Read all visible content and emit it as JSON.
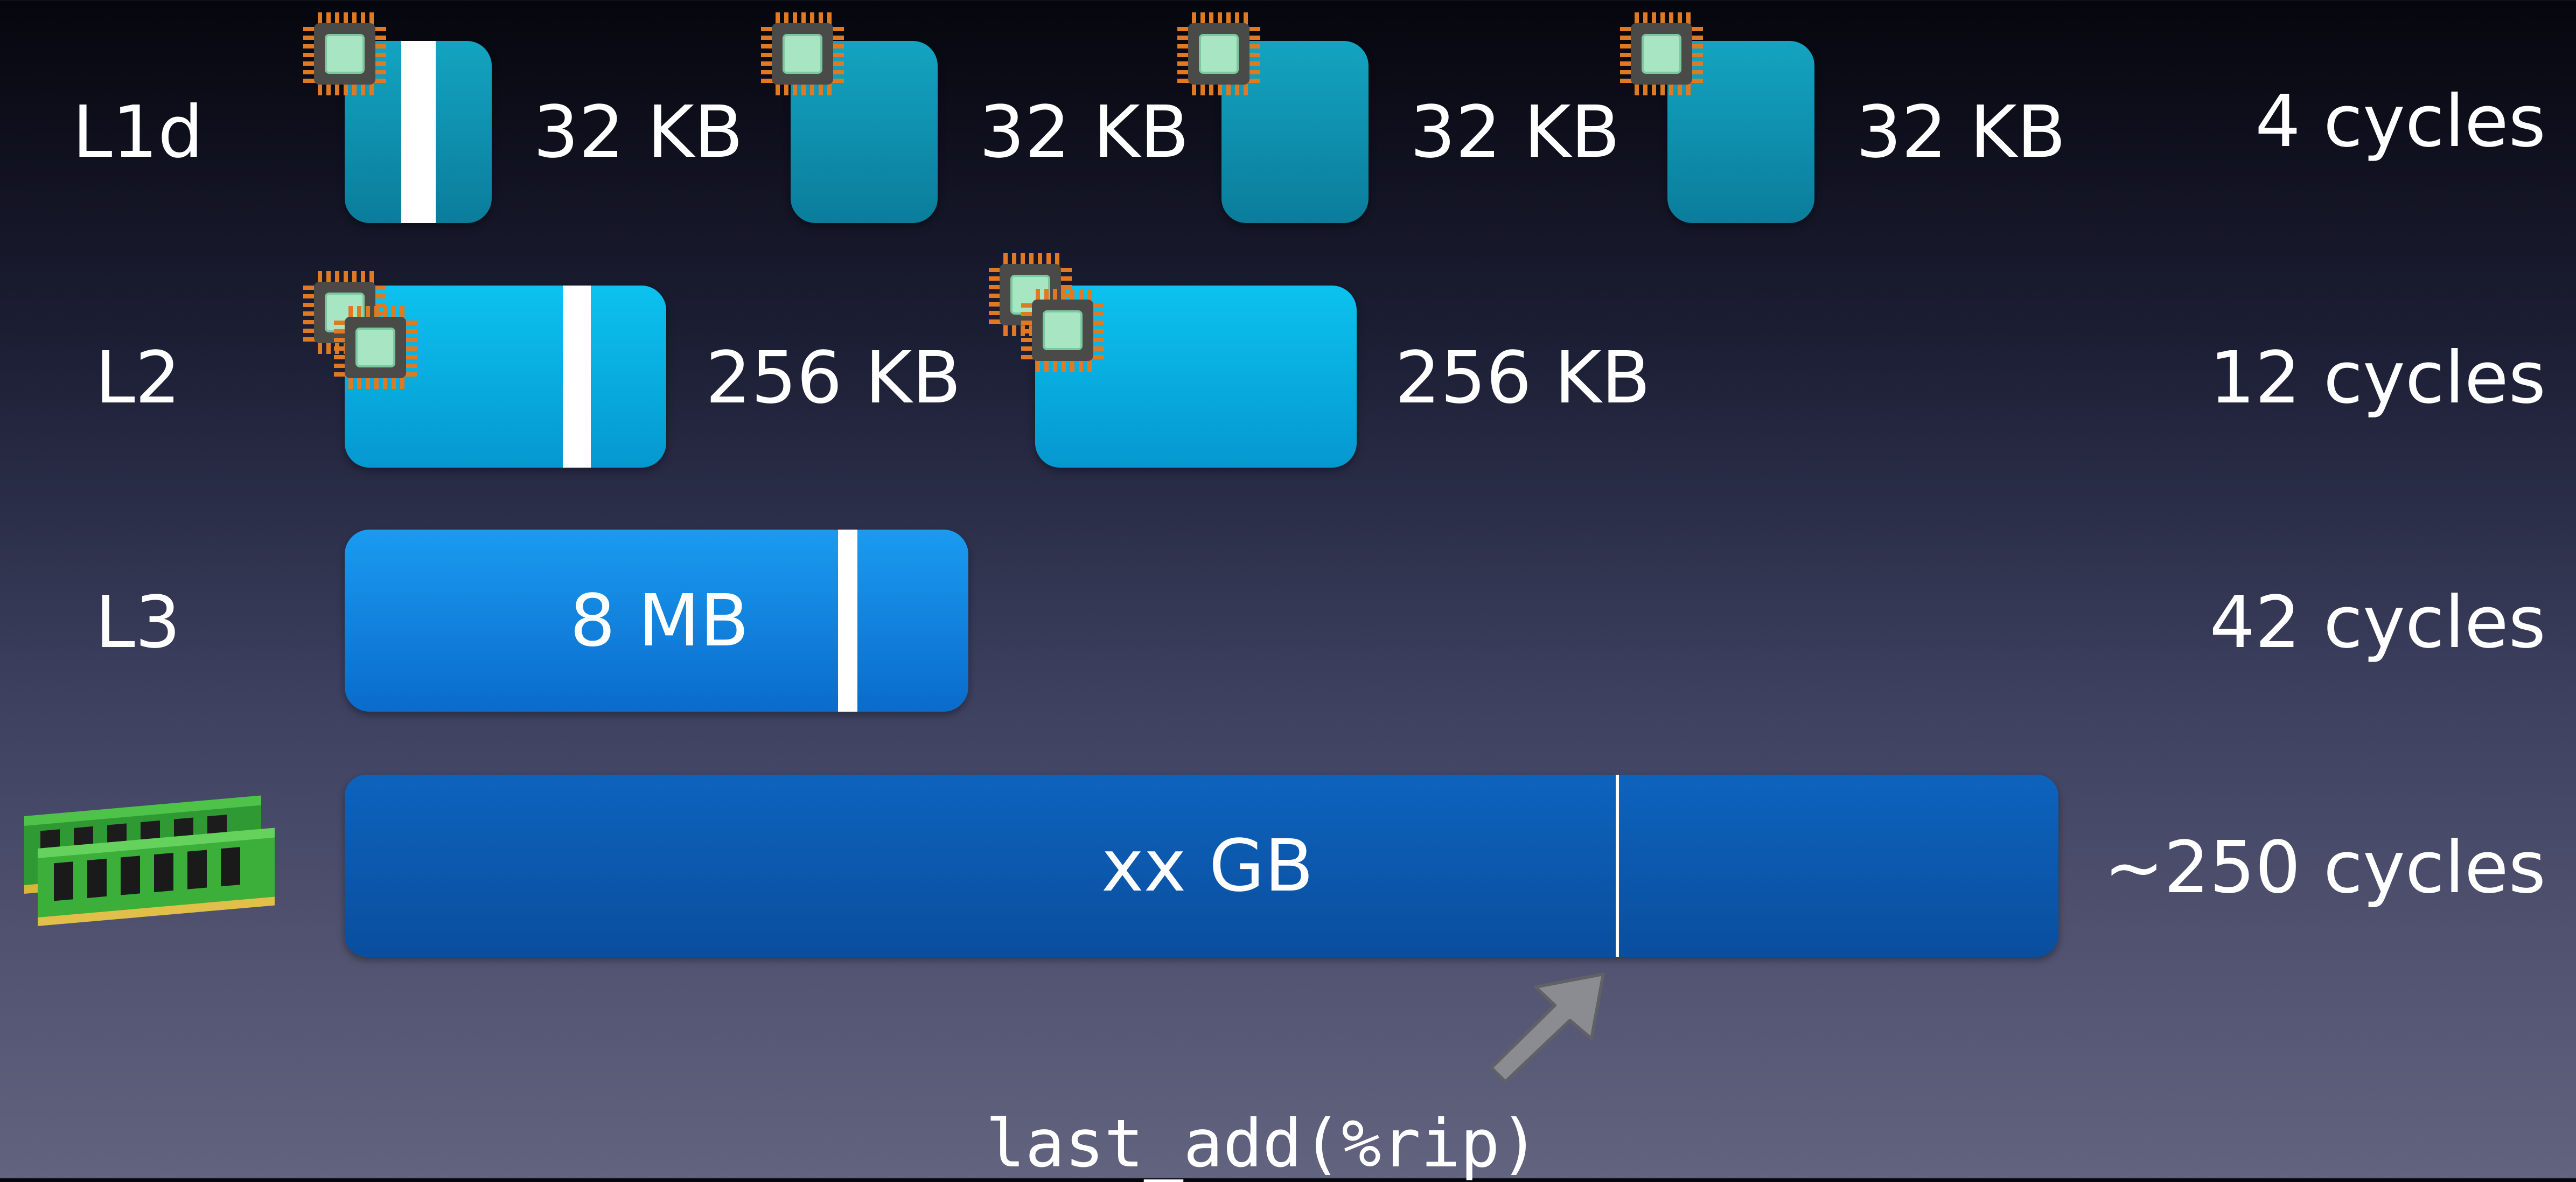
{
  "rows": {
    "l1d": {
      "label": "L1d",
      "size": "32 KB",
      "latency": "4 cycles",
      "caches": [
        "32 KB",
        "32 KB",
        "32 KB",
        "32 KB"
      ]
    },
    "l2": {
      "label": "L2",
      "latency": "12 cycles",
      "caches": [
        "256 KB",
        "256 KB"
      ]
    },
    "l3": {
      "label": "L3",
      "size": "8 MB",
      "latency": "42 cycles"
    },
    "memory": {
      "size": "xx GB",
      "latency": "~250 cycles"
    }
  },
  "pointer_label": "last_add(%rip)",
  "icons": {
    "core": "cpu-chip-icon",
    "memory": "ram-module-icon",
    "pointer": "arrow-icon"
  },
  "colors": {
    "l1": "#0a8aa8",
    "l2": "#09b2e6",
    "l3": "#138de2",
    "memory": "#0b58aa",
    "chip_pins": "#e07a22",
    "chip_core": "#a8e6c3",
    "ram_board": "#3cae3a"
  }
}
